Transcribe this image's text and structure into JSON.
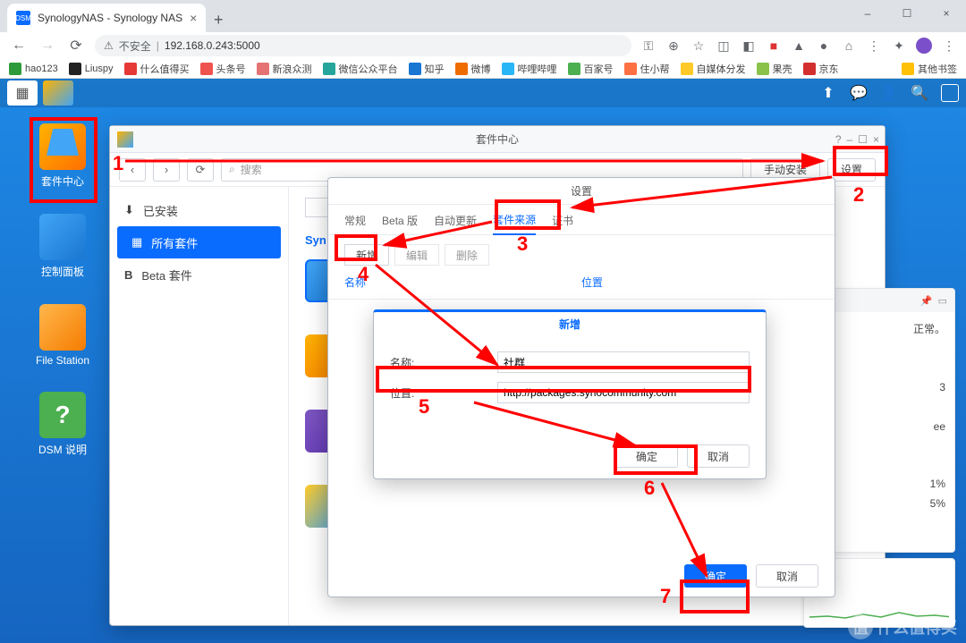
{
  "browser": {
    "tab_title": "SynologyNAS - Synology NAS",
    "url_unsafe": "不安全",
    "url": "192.168.0.243:5000",
    "bookmarks": [
      "hao123",
      "Liuspy",
      "什么值得买",
      "头条号",
      "新浪众测",
      "微信公众平台",
      "知乎",
      "微博",
      "哔哩哔哩",
      "百家号",
      "住小帮",
      "自媒体分发",
      "果壳",
      "京东",
      "其他书签"
    ]
  },
  "dsm": {
    "icons": {
      "package_center": "套件中心",
      "control_panel": "控制面板",
      "file_station": "File Station",
      "dsm_help": "DSM 说明"
    }
  },
  "package_center": {
    "title": "套件中心",
    "search_placeholder": "搜索",
    "btn_manual": "手动安装",
    "btn_settings": "设置",
    "sidebar": {
      "installed": "已安装",
      "all": "所有套件",
      "beta": "Beta 套件"
    },
    "section": "Syn"
  },
  "settings_dialog": {
    "title": "设置",
    "tabs": {
      "general": "常规",
      "beta": "Beta 版",
      "auto_update": "自动更新",
      "sources": "套件来源",
      "cert": "证书"
    },
    "buttons": {
      "add": "新增",
      "edit": "编辑",
      "delete": "删除"
    },
    "columns": {
      "name": "名称",
      "location": "位置"
    },
    "ok": "确定",
    "cancel": "取消"
  },
  "add_dialog": {
    "title": "新增",
    "name_label": "名称:",
    "name_value": "社群",
    "location_label": "位置:",
    "location_value": "http://packages.synocommunity.com",
    "ok": "确定",
    "cancel": "取消"
  },
  "widgets": {
    "status_line1": "正常。",
    "stat1": "3",
    "stat2": "ee",
    "pct1": "1%",
    "pct2": "5%"
  },
  "annotations": {
    "n1": "1",
    "n2": "2",
    "n3": "3",
    "n4": "4",
    "n5": "5",
    "n6": "6",
    "n7": "7"
  },
  "watermark": "什么值得买"
}
